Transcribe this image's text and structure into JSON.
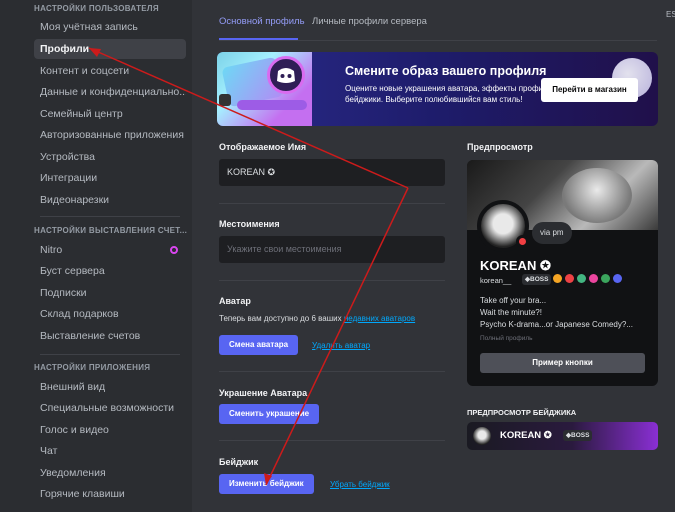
{
  "sidebar": {
    "groups": {
      "user": "НАСТРОЙКИ ПОЛЬЗОВАТЕЛЯ",
      "billing": "НАСТРОЙКИ ВЫСТАВЛЕНИЯ СЧЕТ...",
      "app": "НАСТРОЙКИ ПРИЛОЖЕНИЯ"
    },
    "user_items": [
      "Моя учётная запись",
      "Профили",
      "Контент и соцсети",
      "Данные и конфиденциально...",
      "Семейный центр",
      "Авторизованные приложения",
      "Устройства",
      "Интеграции",
      "Видеонарезки"
    ],
    "billing_items": [
      "Nitro",
      "Буст сервера",
      "Подписки",
      "Склад подарков",
      "Выставление счетов"
    ],
    "app_items": [
      "Внешний вид",
      "Специальные возможности",
      "Голос и видео",
      "Чат",
      "Уведомления",
      "Горячие клавиши"
    ]
  },
  "tabs": [
    "Основной профиль",
    "Личные профили сервера"
  ],
  "esc_label": "ES",
  "banner": {
    "title": "Смените образ вашего профиля",
    "description": "Оцените новые украшения аватара, эффекты профиля и бейджики. Выберите полюбившийся вам стиль!",
    "button": "Перейти в магазин"
  },
  "form": {
    "display_name_label": "Отображаемое Имя",
    "display_name_value": "KOREAN ✪",
    "pronouns_label": "Местоимения",
    "pronouns_placeholder": "Укажите свои местоимения",
    "avatar_label": "Аватар",
    "avatar_hint": "Теперь вам доступно до 6 ваших",
    "avatar_hint_link": "недавних аватаров",
    "avatar_change": "Смена аватара",
    "avatar_remove": "Удалить аватар",
    "decoration_label": "Украшение Аватара",
    "decoration_change": "Сменить украшение",
    "badge_label": "Бейджик",
    "badge_change": "Изменить бейджик",
    "badge_remove": "Убрать бейджик"
  },
  "preview": {
    "heading": "Предпросмотр",
    "status": "via pm",
    "name": "KOREAN ✪",
    "username": "korean__",
    "tag": "◆BOSS",
    "bio": [
      "Take off your bra...",
      "Wait the minute?!",
      "Psycho K-drama...or Japanese Comedy?..."
    ],
    "small": "Полный профиль",
    "button": "Пример кнопки",
    "badge_colors": [
      "#f5a524",
      "#ed4245",
      "#43b581",
      "#eb459e",
      "#3ba55d",
      "#5865f2"
    ]
  },
  "badge_preview": {
    "heading": "ПРЕДПРОСМОТР БЕЙДЖИКА",
    "name": "KOREAN ✪",
    "tag": "◆BOSS"
  },
  "colors": {
    "accent": "#5865f2",
    "link": "#00a8fc",
    "arrow": "#cc1b1b"
  }
}
